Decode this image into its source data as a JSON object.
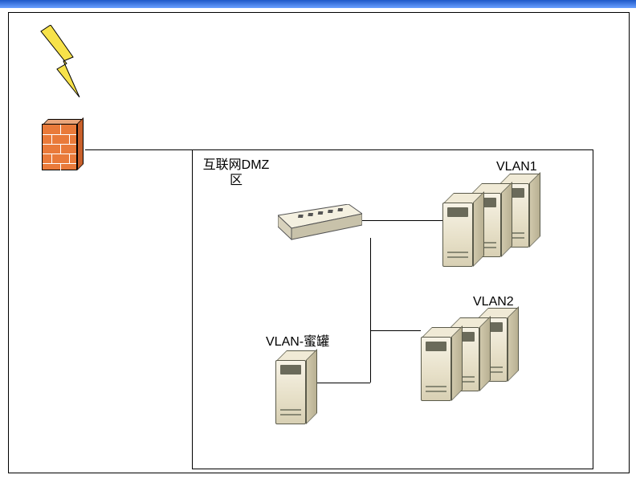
{
  "labels": {
    "dmz": "互联网DMZ\n区",
    "vlan1": "VLAN1",
    "vlan2": "VLAN2",
    "honeypot": "VLAN-蜜罐"
  },
  "topology": {
    "internet_entry": "lightning",
    "perimeter_device": "firewall",
    "zone": "互联网DMZ区",
    "switch_connects": [
      "VLAN1",
      "VLAN2",
      "VLAN-蜜罐"
    ],
    "server_groups": {
      "VLAN1": 3,
      "VLAN2": 3,
      "VLAN-蜜罐": 1
    }
  }
}
